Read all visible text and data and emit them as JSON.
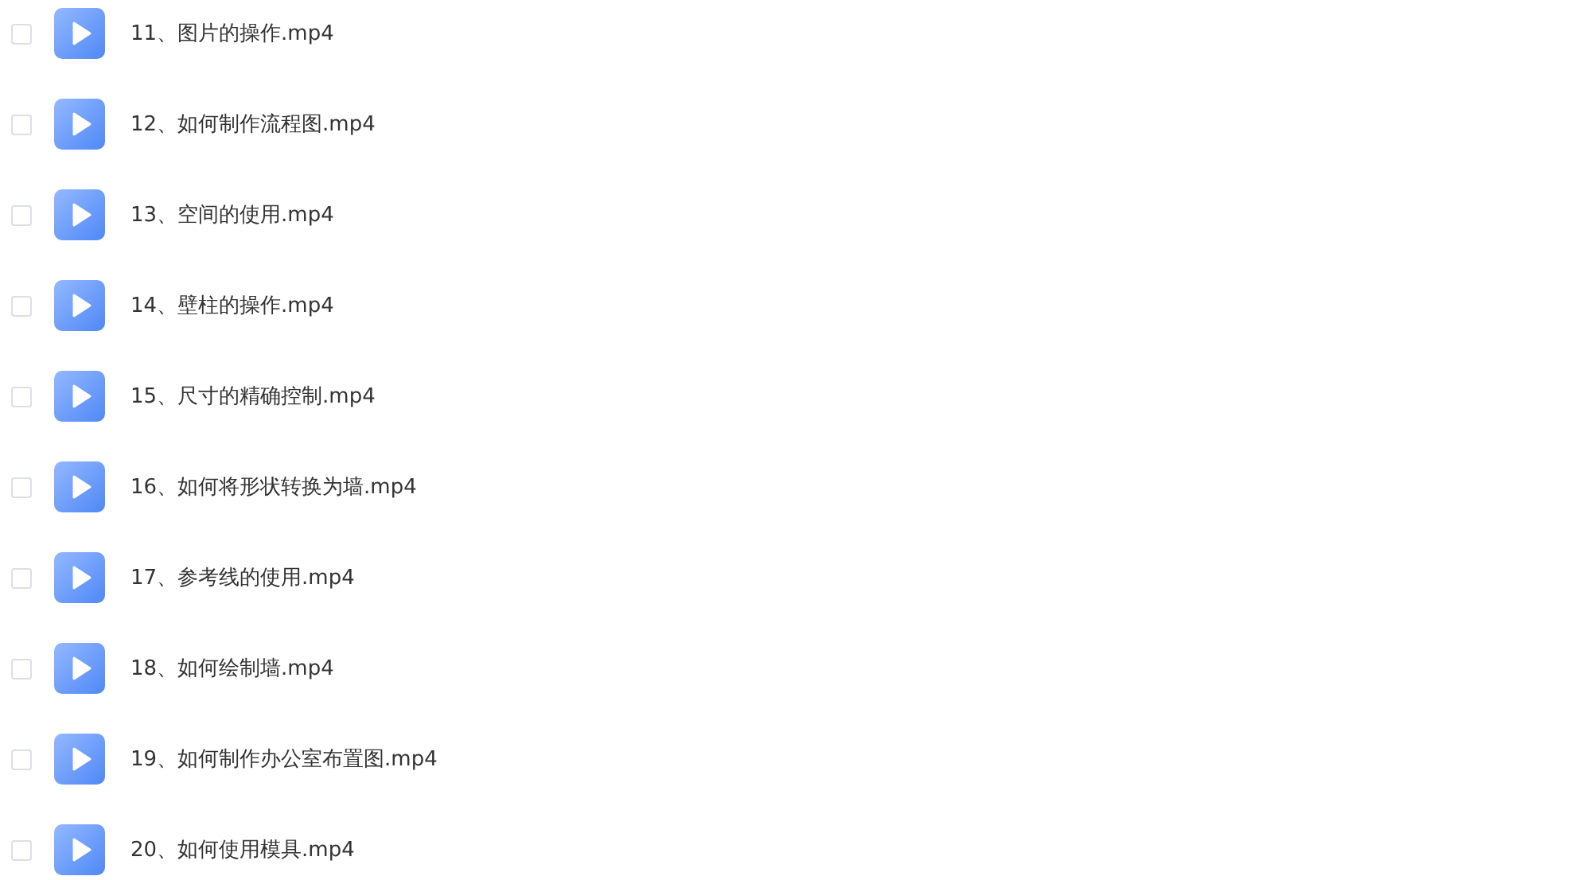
{
  "files": [
    {
      "name": "11、图片的操作.mp4",
      "checked": false
    },
    {
      "name": "12、如何制作流程图.mp4",
      "checked": false
    },
    {
      "name": "13、空间的使用.mp4",
      "checked": false
    },
    {
      "name": "14、壁柱的操作.mp4",
      "checked": false
    },
    {
      "name": "15、尺寸的精确控制.mp4",
      "checked": false
    },
    {
      "name": "16、如何将形状转换为墙.mp4",
      "checked": false
    },
    {
      "name": "17、参考线的使用.mp4",
      "checked": false
    },
    {
      "name": "18、如何绘制墙.mp4",
      "checked": false
    },
    {
      "name": "19、如何制作办公室布置图.mp4",
      "checked": false
    },
    {
      "name": "20、如何使用模具.mp4",
      "checked": false
    }
  ]
}
